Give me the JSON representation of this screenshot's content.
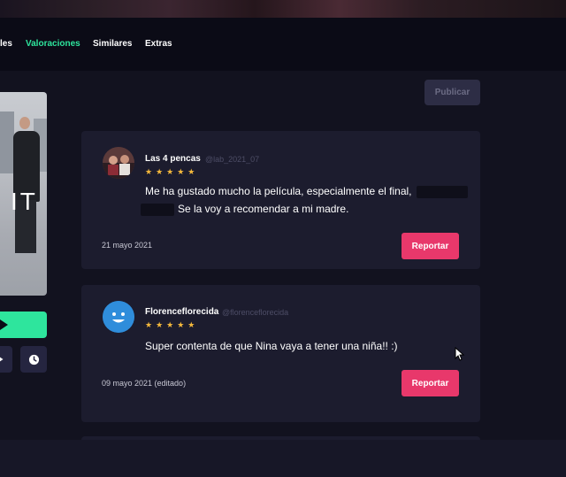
{
  "nav": {
    "tabs": [
      {
        "label": "les",
        "active": false
      },
      {
        "label": "Valoraciones",
        "active": true
      },
      {
        "label": "Similares",
        "active": false
      },
      {
        "label": "Extras",
        "active": false
      }
    ],
    "active_color": "#2ee59d"
  },
  "actions": {
    "publish_label": "Publicar"
  },
  "poster": {
    "title_fragment": "IT"
  },
  "sidebar_icons": [
    "play-icon",
    "share-icon",
    "clock-icon"
  ],
  "reviews": [
    {
      "username": "Las 4 pencas",
      "handle": "@lab_2021_07",
      "rating": 5,
      "stars": "★★★★★",
      "text_part1": "Me ha gustado mucho la película, especialmente el final,",
      "text_part2": "Se la voy a recomendar a mi madre.",
      "date": "21 mayo 2021",
      "report_label": "Reportar"
    },
    {
      "username": "Florenceflorecida",
      "handle": "@florenceflorecida",
      "rating": 5,
      "stars": "★★★★★",
      "text_part1": "Super contenta de que Nina vaya a tener una niña!! :)",
      "date": "09 mayo 2021 (editado)",
      "report_label": "Reportar"
    }
  ],
  "colors": {
    "background": "#12121f",
    "card": "#1c1c2e",
    "report": "#e8386b",
    "star": "#f5b93c",
    "accent": "#2ee59d"
  }
}
